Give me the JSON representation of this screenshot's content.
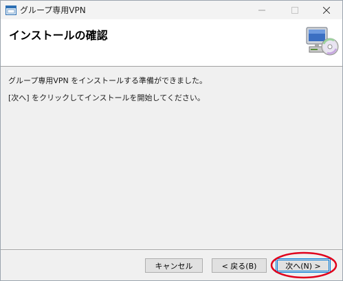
{
  "window": {
    "title": "グループ専用VPN"
  },
  "header": {
    "title": "インストールの確認"
  },
  "body": {
    "line1": "グループ専用VPN をインストールする準備ができました。",
    "line2": "[次へ] をクリックしてインストールを開始してください。"
  },
  "buttons": {
    "cancel": "キャンセル",
    "back": "< 戻る(B)",
    "next": "次へ(N) >"
  },
  "highlight": {
    "color": "#e0001b",
    "target": "next-button"
  }
}
